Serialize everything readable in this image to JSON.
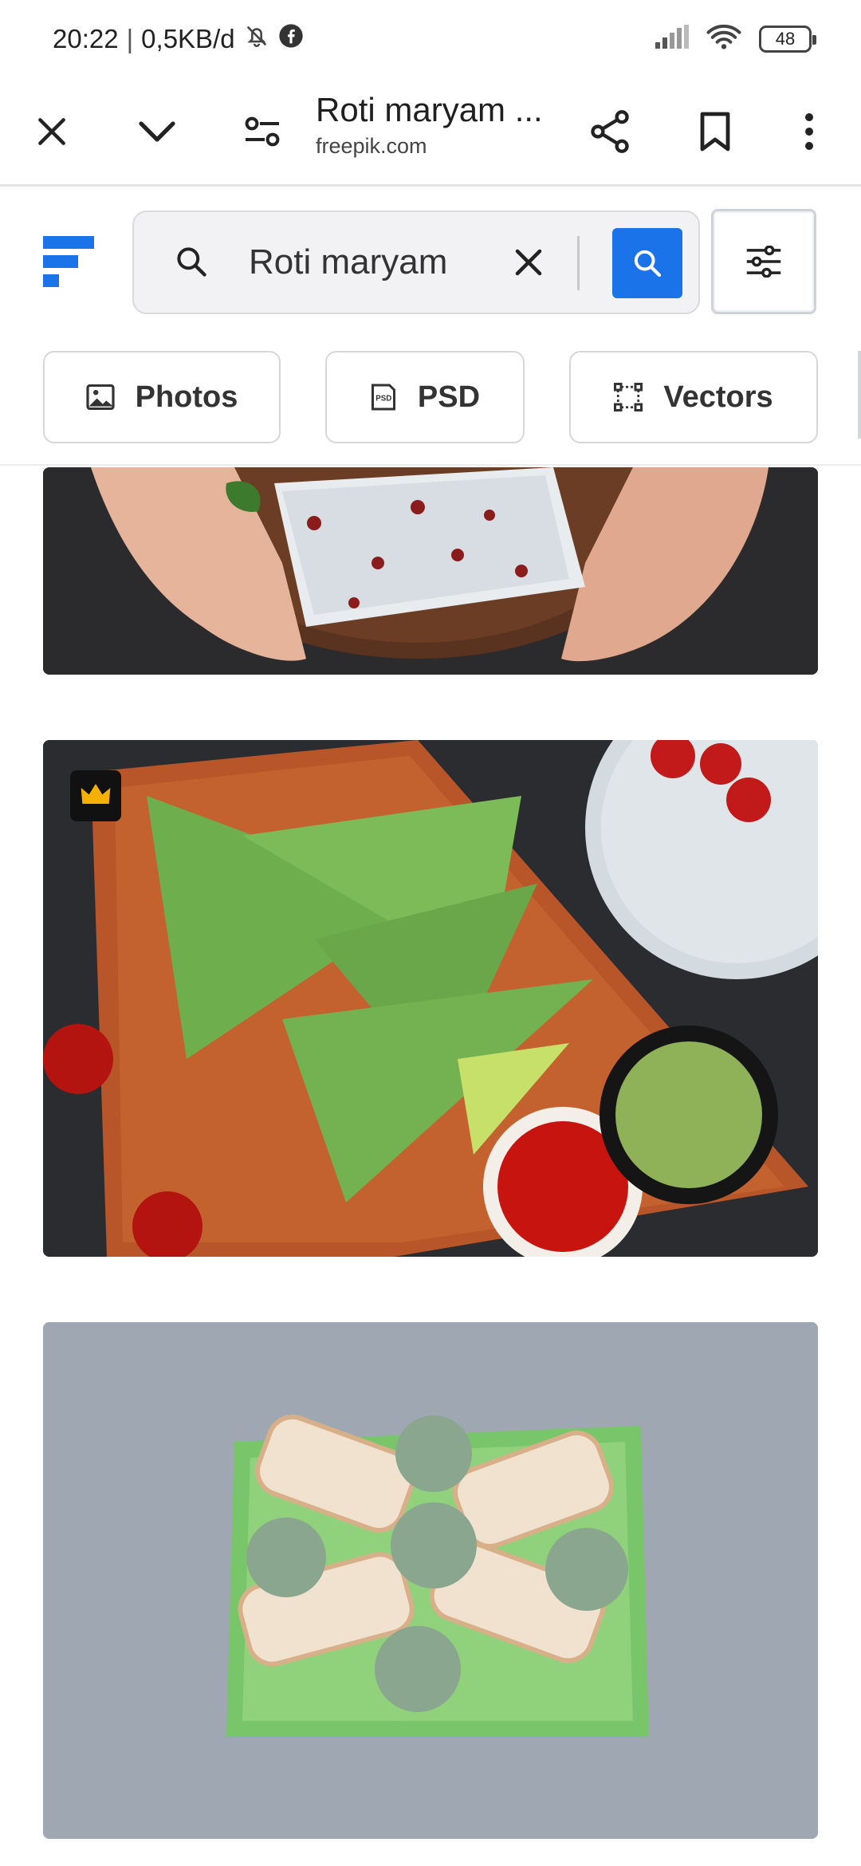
{
  "status": {
    "time": "20:22",
    "network_speed": "0,5KB/d",
    "battery": "48"
  },
  "toolbar": {
    "title": "Roti maryam ...",
    "domain": "freepik.com"
  },
  "search": {
    "query": "Roti maryam"
  },
  "chips": [
    {
      "label": "Photos",
      "icon": "image-icon"
    },
    {
      "label": "PSD",
      "icon": "psd-file-icon"
    },
    {
      "label": "Vectors",
      "icon": "vector-icon"
    }
  ],
  "colors": {
    "accent": "#1a73e8",
    "premium_crown": "#f6b100"
  }
}
